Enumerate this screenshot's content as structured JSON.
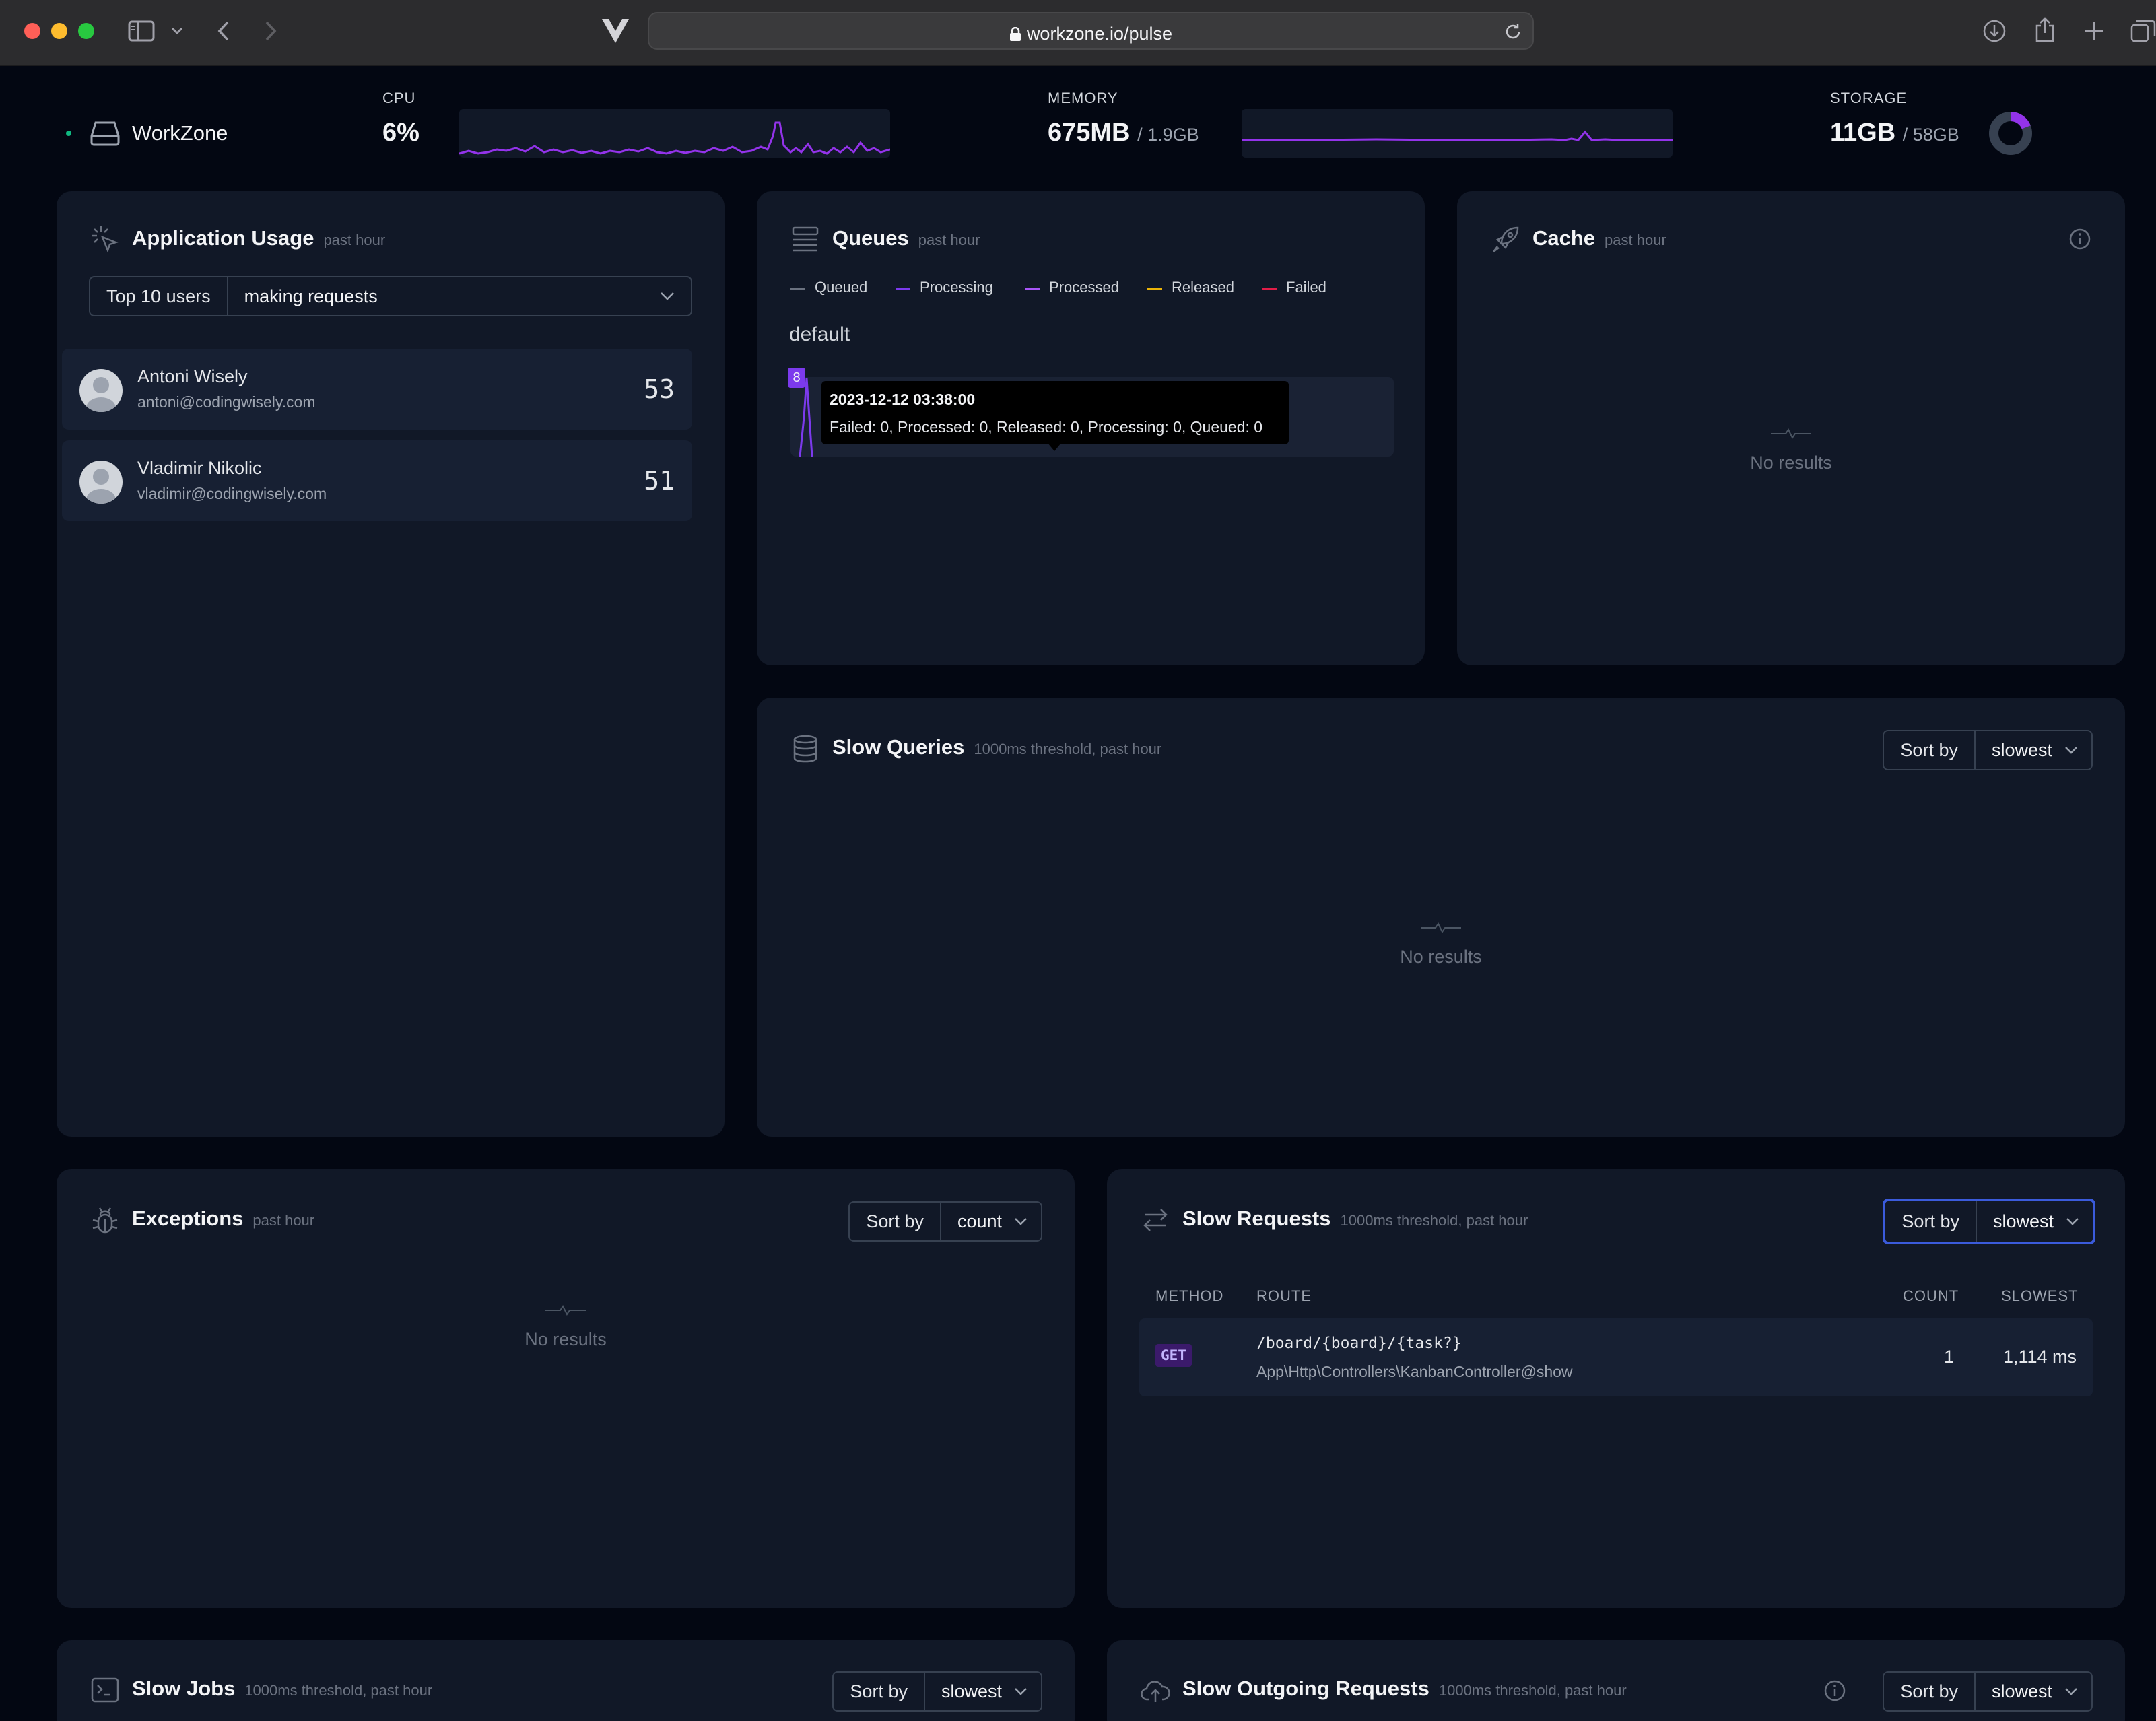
{
  "browser": {
    "url": "workzone.io/pulse"
  },
  "header": {
    "app_name": "WorkZone",
    "cpu": {
      "label": "CPU",
      "value": "6%"
    },
    "memory": {
      "label": "MEMORY",
      "value": "675MB",
      "total": "/ 1.9GB"
    },
    "storage": {
      "label": "STORAGE",
      "value": "11GB",
      "total": "/ 58GB",
      "used_fraction": 0.19
    }
  },
  "usage": {
    "title": "Application Usage",
    "subtitle": "past hour",
    "filter_label": "Top 10 users",
    "filter_value": "making requests",
    "users": [
      {
        "name": "Antoni Wisely",
        "email": "antoni@codingwisely.com",
        "count": "53"
      },
      {
        "name": "Vladimir Nikolic",
        "email": "vladimir@codingwisely.com",
        "count": "51"
      }
    ]
  },
  "queues": {
    "title": "Queues",
    "subtitle": "past hour",
    "legend": [
      {
        "label": "Queued",
        "color": "#6b7280"
      },
      {
        "label": "Processing",
        "color": "#7c3aed"
      },
      {
        "label": "Processed",
        "color": "#a855f7"
      },
      {
        "label": "Released",
        "color": "#eab308"
      },
      {
        "label": "Failed",
        "color": "#e11d48"
      }
    ],
    "queue_name": "default",
    "badge": "8",
    "tooltip_time": "2023-12-12 03:38:00",
    "tooltip_text": "Failed: 0, Processed: 0, Released: 0, Processing: 0, Queued: 0"
  },
  "cache": {
    "title": "Cache",
    "subtitle": "past hour",
    "empty": "No results"
  },
  "slow_queries": {
    "title": "Slow Queries",
    "subtitle": "1000ms threshold, past hour",
    "sort_label": "Sort by",
    "sort_value": "slowest",
    "empty": "No results"
  },
  "exceptions": {
    "title": "Exceptions",
    "subtitle": "past hour",
    "sort_label": "Sort by",
    "sort_value": "count",
    "empty": "No results"
  },
  "slow_requests": {
    "title": "Slow Requests",
    "subtitle": "1000ms threshold, past hour",
    "sort_label": "Sort by",
    "sort_value": "slowest",
    "columns": {
      "method": "METHOD",
      "route": "ROUTE",
      "count": "COUNT",
      "slowest": "SLOWEST"
    },
    "rows": [
      {
        "method": "GET",
        "route": "/board/{board}/{task?}",
        "action": "App\\Http\\Controllers\\KanbanController@show",
        "count": "1",
        "slowest": "1,114 ms"
      }
    ]
  },
  "slow_jobs": {
    "title": "Slow Jobs",
    "subtitle": "1000ms threshold, past hour",
    "sort_label": "Sort by",
    "sort_value": "slowest"
  },
  "slow_outgoing": {
    "title": "Slow Outgoing Requests",
    "subtitle": "1000ms threshold, past hour",
    "sort_label": "Sort by",
    "sort_value": "slowest"
  }
}
